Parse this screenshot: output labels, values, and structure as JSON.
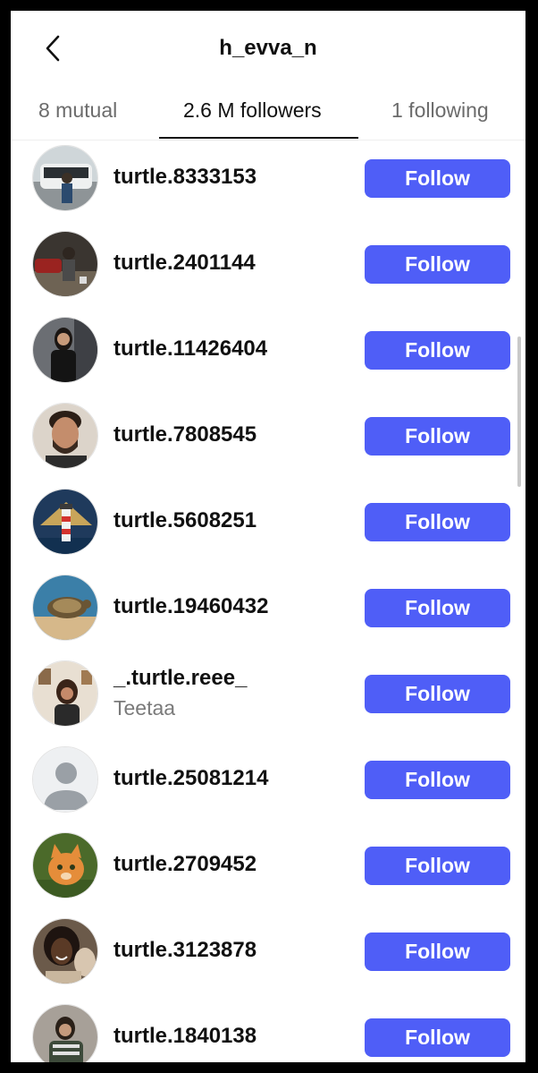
{
  "header": {
    "title": "h_evva_n",
    "back_icon": "chevron-left-icon"
  },
  "tabs": [
    {
      "label": "8 mutual",
      "active": false
    },
    {
      "label": "2.6 M followers",
      "active": true
    },
    {
      "label": "1 following",
      "active": false
    }
  ],
  "users": [
    {
      "username": "turtle.8333153",
      "subtitle": "",
      "button": "Follow"
    },
    {
      "username": "turtle.2401144",
      "subtitle": "",
      "button": "Follow"
    },
    {
      "username": "turtle.11426404",
      "subtitle": "",
      "button": "Follow"
    },
    {
      "username": "turtle.7808545",
      "subtitle": "",
      "button": "Follow"
    },
    {
      "username": "turtle.5608251",
      "subtitle": "",
      "button": "Follow"
    },
    {
      "username": "turtle.19460432",
      "subtitle": "",
      "button": "Follow"
    },
    {
      "username": "_.turtle.reee_",
      "subtitle": "Teetaa",
      "button": "Follow"
    },
    {
      "username": "turtle.25081214",
      "subtitle": "",
      "button": "Follow"
    },
    {
      "username": "turtle.2709452",
      "subtitle": "",
      "button": "Follow"
    },
    {
      "username": "turtle.3123878",
      "subtitle": "",
      "button": "Follow"
    },
    {
      "username": "turtle.1840138",
      "subtitle": "",
      "button": "Follow"
    }
  ],
  "colors": {
    "follow_button": "#4f5ef7",
    "text": "#111111",
    "muted": "#6b6b6b"
  }
}
